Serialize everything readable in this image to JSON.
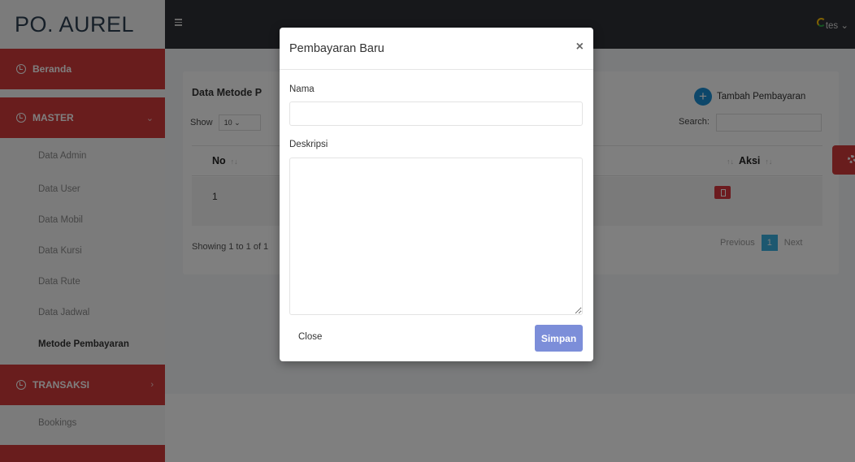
{
  "brand": "PO. AUREL",
  "sidebar": {
    "beranda": "Beranda",
    "master": "MASTER",
    "master_arrow": "⌄",
    "items": [
      "Data Admin",
      "Data User",
      "Data Mobil",
      "Data Kursi",
      "Data Rute",
      "Data Jadwal",
      "Metode Pembayaran"
    ],
    "transaksi": "TRANSAKSI",
    "transaksi_arrow": "›",
    "bookings": "Bookings"
  },
  "topbar": {
    "menu_icon": "hamburger-icon",
    "user": "tes ⌄"
  },
  "card": {
    "title": "Data Metode P",
    "show_label": "Show",
    "show_value": "10 ⌄",
    "add_label": "Tambah Pembayaran",
    "search_label": "Search:",
    "col_no": "No",
    "col_aksi": "Aksi",
    "sort_icon": "↑↓",
    "row_no": "1",
    "showing": "Showing 1 to 1 of 1",
    "prev": "Previous",
    "page": "1",
    "next": "Next"
  },
  "modal": {
    "title": "Pembayaran Baru",
    "close_x": "×",
    "nama_label": "Nama",
    "nama_value": "",
    "deskripsi_label": "Deskripsi",
    "deskripsi_value": "",
    "close_btn": "Close",
    "save_btn": "Simpan"
  },
  "colors": {
    "accent_red": "#d23b3b",
    "topbar": "#2f3136",
    "primary_btn": "#7c8ed9",
    "add_btn": "#1b8fd4"
  }
}
